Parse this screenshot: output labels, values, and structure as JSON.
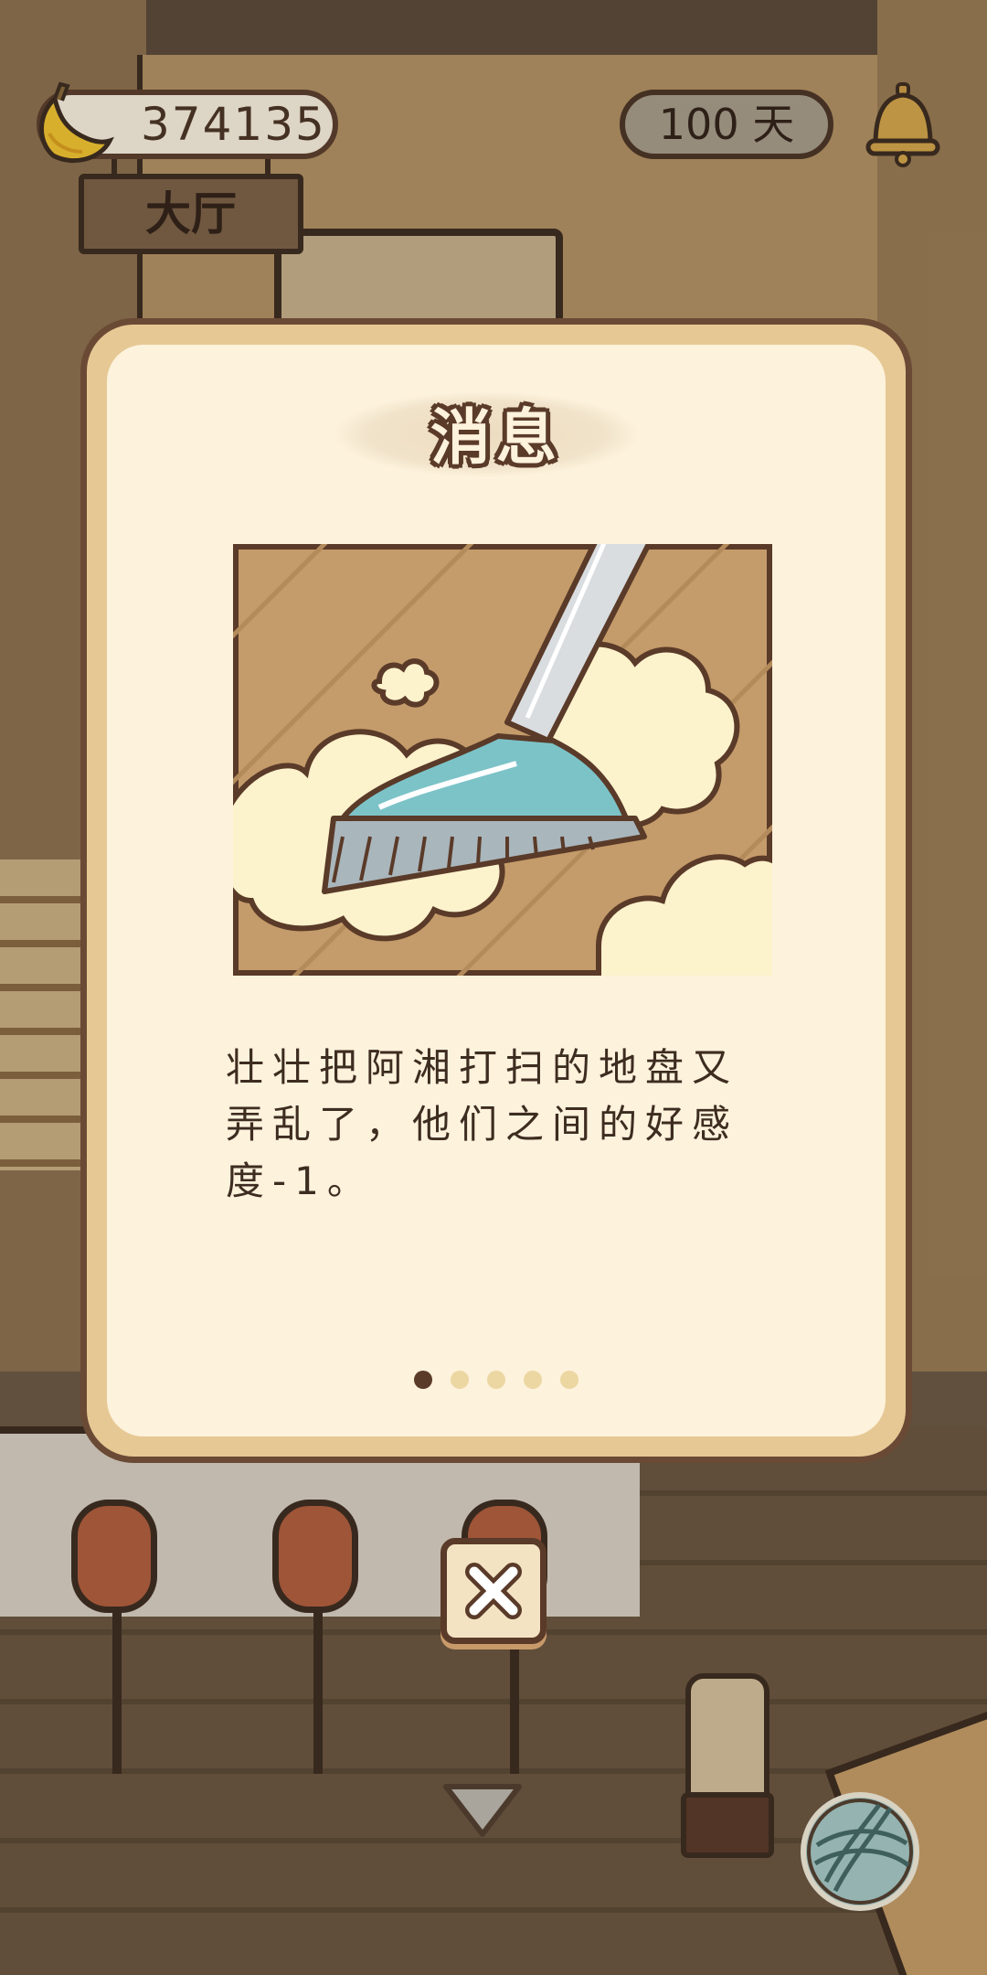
{
  "hud": {
    "banana_count": "374135",
    "days": "100 天",
    "room_sign": "大厅"
  },
  "dialog": {
    "title": "消息",
    "message": "壮壮把阿湘打扫的地盘又弄乱了，他们之间的好感度-1。",
    "page_total": 5,
    "page_current": 1
  },
  "icons": {
    "currency": "banana-icon",
    "notifications": "bell-icon",
    "close": "close-icon",
    "expand": "chevron-down-icon",
    "action": "yarn-ball-icon"
  },
  "colors": {
    "panel_border": "#6a4a35",
    "panel_fill": "#fdf2dc",
    "active_dot": "#5a3a28",
    "inactive_dot": "#ecd7a2",
    "broom": "#7cc3c8"
  }
}
